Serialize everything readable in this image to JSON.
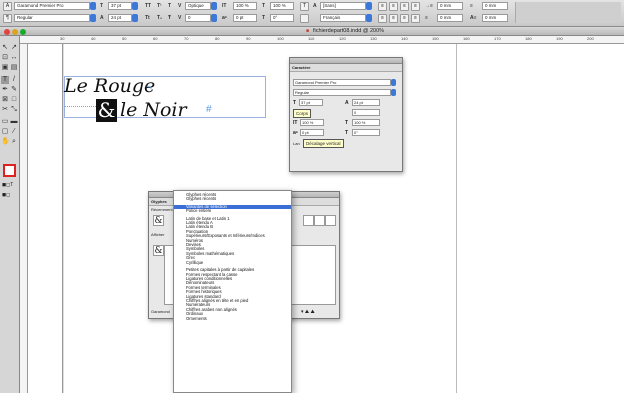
{
  "window": {
    "title": "fichierdepart08.indd @ 200%"
  },
  "control_bar": {
    "font_family": "Garamond Premier Pro",
    "font_style": "Regular",
    "font_size": "37 pt",
    "leading": "24 pt",
    "scale_v": "100 %",
    "scale_h": "100 %",
    "tracking": "0",
    "kerning": "Optique",
    "baseline": "0 pt",
    "skew": "0°",
    "char_style": "[Sans]",
    "language": "Français",
    "indent_1": "0 mm",
    "indent_2": "0 mm",
    "indent_3": "0 mm",
    "indent_4": "0 mm",
    "tt": "TT",
    "t1": "T¹",
    "tsub": "T₁",
    "tt2": "Tt",
    "t_under": "T",
    "t_strike": "Ŧ",
    "color_a": "A"
  },
  "ruler": {
    "ticks": [
      "30",
      "40",
      "50",
      "60",
      "70",
      "80",
      "90",
      "100",
      "110",
      "120",
      "130",
      "140",
      "150",
      "160",
      "170",
      "180",
      "190",
      "200"
    ]
  },
  "doc_text": {
    "line1": "Le Rouge",
    "amp": "&",
    "line2": "le Noir"
  },
  "char_panel": {
    "title": "Caractère",
    "font": "Garamond Premier Pro",
    "style": "Regular",
    "size": "37 pt",
    "leading": "24 pt",
    "kern_label": "Corps",
    "tracking": "0",
    "scale_v": "100 %",
    "scale_h": "100 %",
    "baseline": "0 pt",
    "skew": "0°",
    "lang_label": "Lan",
    "tooltip": "Décalage vertical"
  },
  "glyph_panel": {
    "title": "Glyphes",
    "recent_label": "Récemment",
    "show_label": "Afficher",
    "font_label": "Garamond",
    "glyph": "&"
  },
  "glyph_menu": {
    "items": [
      "Glyphes récents",
      "Glyphes récents",
      "",
      "Variantes de sélection",
      "Police entière",
      "",
      "Latin de base et Latin 1",
      "Latin étendu A",
      "Latin étendu B",
      "Ponctuation",
      "Supérieurs/Exposants et Inférieurs/Indices",
      "Numéros",
      "Devises",
      "Symboles",
      "Symboles mathématiques",
      "Grec",
      "Cyrillique",
      "",
      "Petites capitales à partir de capitales",
      "Formes respectant la casse",
      "Ligatures conditionnelles",
      "Dénominateurs",
      "Formes terminales",
      "Formes historiques",
      "Ligatures standard",
      "Chiffres alignés en tête et en pied",
      "Numérateurs",
      "Chiffres arabes non alignés",
      "Ordinaux",
      "Ornements"
    ],
    "selected_index": 3
  }
}
